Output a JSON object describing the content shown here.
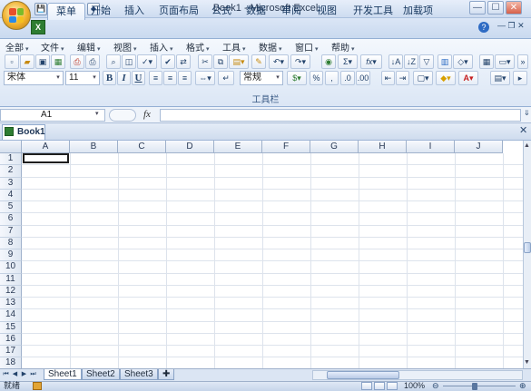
{
  "window": {
    "title": "Book1 - Microsoft Excel",
    "controls": [
      "—",
      "☐",
      "✕"
    ]
  },
  "quick_access": [
    "💾",
    "↶",
    "↷",
    "◆"
  ],
  "ribbon_tabs": [
    "菜单",
    "开始",
    "插入",
    "页面布局",
    "公式",
    "数据",
    "审阅",
    "视图",
    "开发工具",
    "加载项"
  ],
  "active_tab": "菜单",
  "menu_bar": [
    "全部",
    "文件",
    "编辑",
    "视图",
    "插入",
    "格式",
    "工具",
    "数据",
    "窗口",
    "帮助"
  ],
  "toolbar": {
    "font_name": "宋体",
    "font_size": "11",
    "number_format": "常规",
    "bold": "B",
    "italic": "I",
    "underline": "U",
    "sigma": "Σ",
    "fx": "fx",
    "percent": "%",
    "comma": ",",
    "group_label": "工具栏"
  },
  "formula_bar": {
    "name_box": "A1",
    "fx_label": "fx",
    "value": ""
  },
  "document_tab": "Book1",
  "columns": [
    "A",
    "B",
    "C",
    "D",
    "E",
    "F",
    "G",
    "H",
    "I",
    "J"
  ],
  "rows": [
    "1",
    "2",
    "3",
    "4",
    "5",
    "6",
    "7",
    "8",
    "9",
    "10",
    "11",
    "12",
    "13",
    "14",
    "15",
    "16",
    "17",
    "18"
  ],
  "sheets": [
    "Sheet1",
    "Sheet2",
    "Sheet3"
  ],
  "active_sheet": "Sheet1",
  "status": {
    "text": "就绪",
    "zoom": "100%"
  },
  "colors": {
    "ribbon_blue": "#dbe6f5",
    "accent": "#15365e"
  }
}
